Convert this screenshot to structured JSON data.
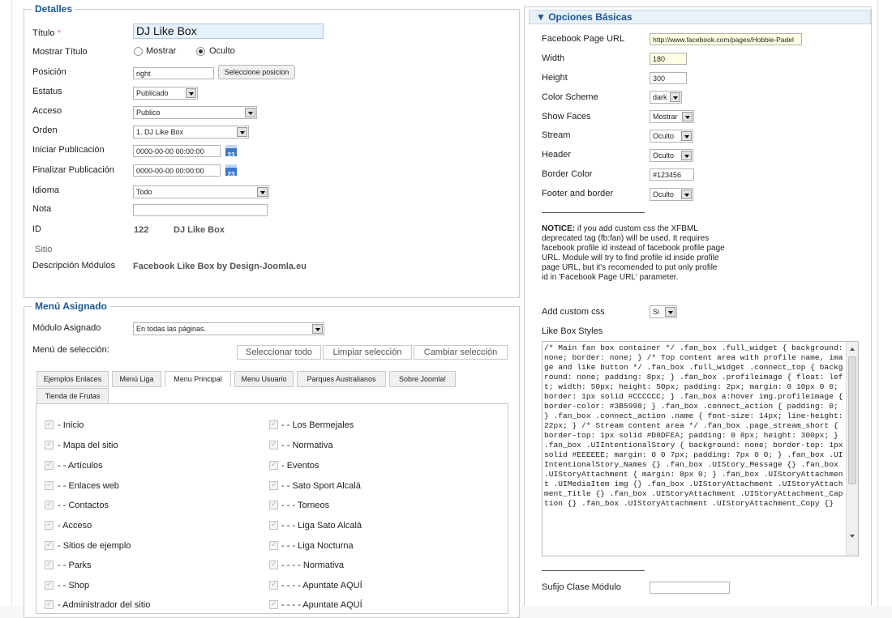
{
  "detalles": {
    "legend": "Detalles",
    "titulo_label": "Título",
    "required_mark": "*",
    "titulo_value": "DJ Like Box",
    "mostrar_titulo_label": "Mostrar Título",
    "radio_mostrar": "Mostrar",
    "radio_oculto": "Oculto",
    "posicion_label": "Posición",
    "posicion_value": "right",
    "posicion_button": "Seleccione posicion",
    "estatus_label": "Estatus",
    "estatus_value": "Publicado",
    "acceso_label": "Acceso",
    "acceso_value": "Publico",
    "orden_label": "Orden",
    "orden_value": "1. DJ Like Box",
    "iniciar_label": "Iniciar Publicación",
    "iniciar_value": "0000-00-00 00:00:00",
    "finalizar_label": "Finalizar Publicación",
    "finalizar_value": "0000-00-00 00:00:00",
    "calendar_icon_text": "23",
    "idioma_label": "Idioma",
    "idioma_value": "Todo",
    "nota_label": "Nota",
    "nota_value": "",
    "id_label": "ID",
    "id_value": "122",
    "id_name": "DJ Like Box",
    "sitio_label": "Sitio",
    "descripcion_label": "Descripción Módulos",
    "descripcion_value": "Facebook Like Box by Design-Joomla.eu"
  },
  "menu": {
    "legend": "Menú Asignado",
    "modulo_asignado_label": "Módulo Asignado",
    "modulo_asignado_value": "En todas las páginas.",
    "menu_seleccion_label": "Menú de selección:",
    "select_all": "Seleccionar todo",
    "clear_selection": "Limpiar selección",
    "change_selection": "Cambiar selección",
    "tabs": [
      "Ejemplos Enlaces",
      "Menú Liga",
      "Menu Principal",
      "Menu Usuario",
      "Parques Australianos",
      "Sobre Joomla!",
      "Tienda de Frutas"
    ],
    "active_tab": "Menu Principal",
    "items_left": [
      "- Inicio",
      "- Mapa del sitio",
      "- - Artículos",
      "- - Enlaces web",
      "- - Contactos",
      "- Acceso",
      "- Sitios de ejemplo",
      "- - Parks",
      "- - Shop",
      "- Administrador del sitio"
    ],
    "items_right": [
      "- - Los Bermejales",
      "- - Normativa",
      "- Eventos",
      "- - Sato Sport Alcalá",
      "- - - Torneos",
      "- - - Liga Sato Alcalá",
      "- - - Liga Nocturna",
      "- - - - Normativa",
      "- - - - Apuntate AQUÍ",
      "- - - - Apuntate AQUÍ"
    ]
  },
  "opciones": {
    "header": "▼ Opciones Básicas",
    "rows": [
      {
        "label": "Facebook Page URL",
        "value": "http://www.facebook.com/pages/Hobbie-Padel"
      },
      {
        "label": "Width",
        "value": "180"
      },
      {
        "label": "Height",
        "value": "300"
      },
      {
        "label": "Color Scheme",
        "value": "dark"
      },
      {
        "label": "Show Faces",
        "value": "Mostrar"
      },
      {
        "label": "Stream",
        "value": "Oculto"
      },
      {
        "label": "Header",
        "value": "Oculto"
      },
      {
        "label": "Border Color",
        "value": "#123456"
      },
      {
        "label": "Footer and border",
        "value": "Oculto"
      }
    ],
    "notice_strong": "NOTICE:",
    "notice_text": " if you add custom css the XFBML deprecated tag (fb:fan) will be used. It requires facebook profile id instead of facebook profile page URL. Module will try to find profile id inside profile page URL, but it's recomended to put only profile id in 'Facebook Page URL' parameter.",
    "custom_css_label": "Add custom css",
    "custom_css_value": "Si",
    "like_box_styles_label": "Like Box Styles",
    "like_box_styles_value": "/* Main fan box container */ .fan_box .full_widget { background: none;     border: none; }  /* Top content area with profile name, image and like button */ .fan_box .full_widget .connect_top {     background: none; padding: 8px; } .fan_box .profileimage {     float: left;     width: 50px;     height: 50px;     padding: 2px;     margin: 0 10px 0 0;     border: 1px solid #CCCCCC; } .fan_box a:hover img.profileimage {     border-color: #3B5998; } .fan_box .connect_action {     padding: 0; } .fan_box .connect_action .name {     font-size: 14px; line-height: 22px; }  /* Stream content area */ .fan_box .page_stream_short {     border-top: 1px solid #D8DFEA; padding: 0 8px;     height: 300px; } .fan_box .UIIntentionalStory {     background: none;     border-top: 1px solid #EEEEEE;     margin: 0 0 7px;     padding: 7px 0 0; } .fan_box .UIIntentionalStory_Names {} .fan_box .UIStory_Message {} .fan_box .UIStoryAttachment { margin: 8px 0; } .fan_box .UIStoryAttachment .UIMediaItem img {} .fan_box .UIStoryAttachment .UIStoryAttachment_Title {} .fan_box .UIStoryAttachment .UIStoryAttachment_Caption {} .fan_box .UIStoryAttachment .UIStoryAttachment_Copy {}",
    "sufijo_label": "Sufijo Clase Módulo",
    "sufijo_value": ""
  }
}
